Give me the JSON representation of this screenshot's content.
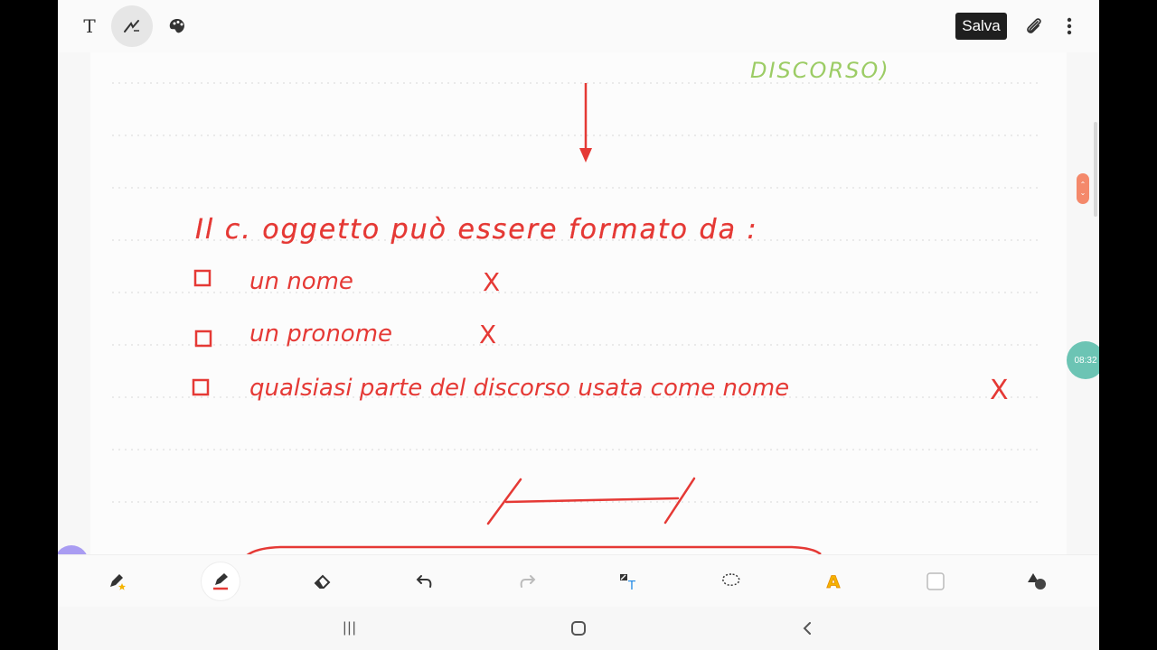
{
  "toolbar": {
    "text_tool_glyph": "T",
    "save_label": "Salva",
    "icons": [
      "text-tool-icon",
      "pen-mode-icon",
      "palette-icon",
      "attach-icon",
      "more-vertical-icon"
    ]
  },
  "note": {
    "header_fragment": "DISCORSO)",
    "heading": "Il c. oggetto può essere formato da :",
    "items": [
      {
        "text": "un nome",
        "mark": "X"
      },
      {
        "text": "un pronome",
        "mark": "X"
      },
      {
        "text": "qualsiasi parte del discorso usata come nome",
        "mark": "X"
      }
    ],
    "colors": {
      "ink_red": "#e53935",
      "ink_green": "#9ccc65",
      "line": "#d9d9d9"
    }
  },
  "side": {
    "time": "08:32",
    "scroll_up": "⌃",
    "scroll_down": "⌄"
  },
  "bottom_toolbar": {
    "tools": [
      "favorite-pen-icon",
      "pen-icon",
      "eraser-icon",
      "undo-icon",
      "redo-icon",
      "handwriting-to-text-icon",
      "lasso-icon",
      "highlighter-icon",
      "color-swatch-icon",
      "shapes-icon"
    ],
    "highlighter_glyph": "A",
    "text_convert_glyph": "T"
  },
  "navigation": {
    "recents_glyph": "|||"
  }
}
